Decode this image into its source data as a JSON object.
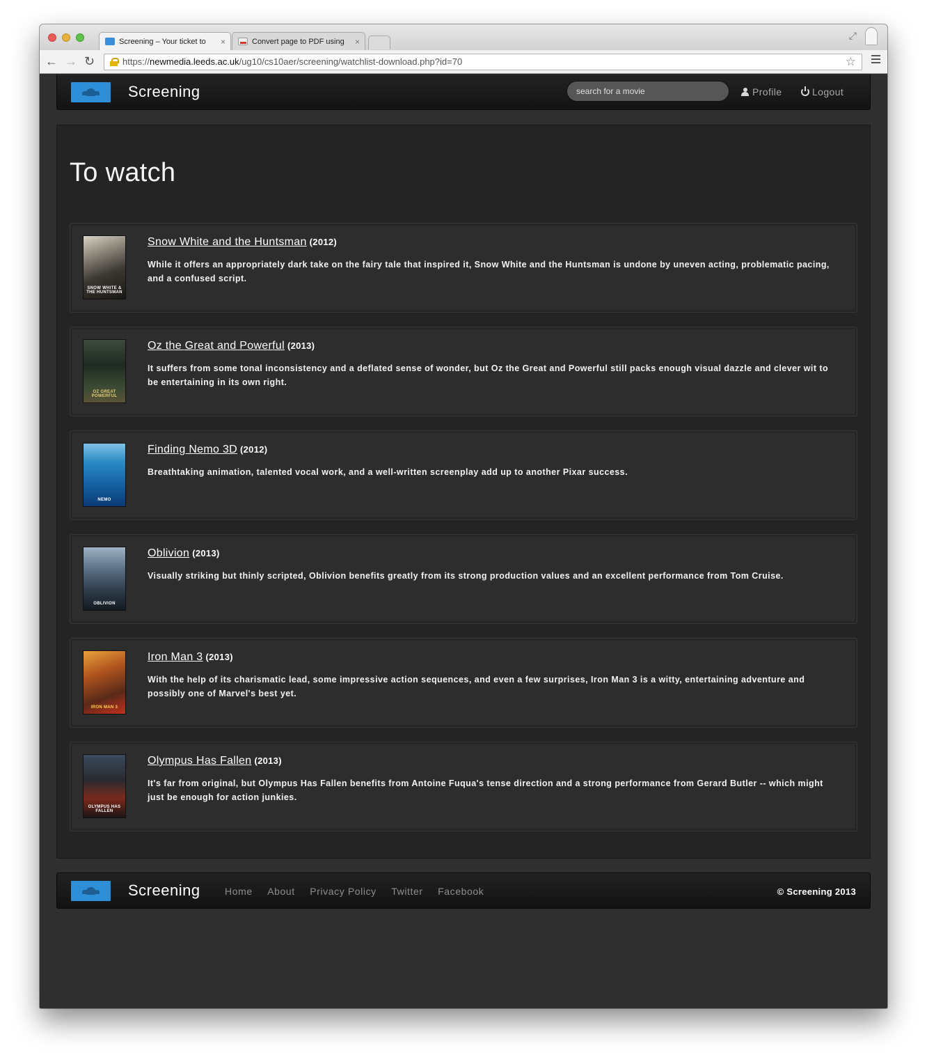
{
  "browser": {
    "tabs": [
      {
        "label": "Screening – Your ticket to"
      },
      {
        "label": "Convert page to PDF using"
      }
    ],
    "url_scheme": "https://",
    "url_host": "newmedia.leeds.ac.uk",
    "url_path": "/ug10/cs10aer/screening/watchlist-download.php?id=70"
  },
  "navbar": {
    "brand": "Screening",
    "search_placeholder": "search for a movie",
    "profile_label": "Profile",
    "logout_label": "Logout"
  },
  "main": {
    "title": "To watch",
    "movies": [
      {
        "title": "Snow White and the Huntsman",
        "year": "(2012)",
        "description": "While it offers an appropriately dark take on the fairy tale that inspired it, Snow White and the Huntsman is undone by uneven acting, problematic pacing, and a confused script.",
        "poster_text": "SNOW WHITE & THE HUNTSMAN"
      },
      {
        "title": "Oz the Great and Powerful",
        "year": "(2013)",
        "description": "It suffers from some tonal inconsistency and a deflated sense of wonder, but Oz the Great and Powerful still packs enough visual dazzle and clever wit to be entertaining in its own right.",
        "poster_text": "OZ GREAT POWERFUL"
      },
      {
        "title": "Finding Nemo 3D",
        "year": "(2012)",
        "description": "Breathtaking animation, talented vocal work, and a well-written screenplay add up to another Pixar success.",
        "poster_text": "NEMO"
      },
      {
        "title": "Oblivion",
        "year": "(2013)",
        "description": "Visually striking but thinly scripted, Oblivion benefits greatly from its strong production values and an excellent performance from Tom Cruise.",
        "poster_text": "OBLIVION"
      },
      {
        "title": "Iron Man 3",
        "year": "(2013)",
        "description": "With the help of its charismatic lead, some impressive action sequences, and even a few surprises, Iron Man 3 is a witty, entertaining adventure and possibly one of Marvel's best yet.",
        "poster_text": "IRON MAN 3"
      },
      {
        "title": "Olympus Has Fallen",
        "year": "(2013)",
        "description": "It's far from original, but Olympus Has Fallen benefits from Antoine Fuqua's tense direction and a strong performance from Gerard Butler -- which might just be enough for action junkies.",
        "poster_text": "OLYMPUS HAS FALLEN"
      }
    ]
  },
  "footer": {
    "brand": "Screening",
    "links": [
      "Home",
      "About",
      "Privacy Policy",
      "Twitter",
      "Facebook"
    ],
    "copyright": "© Screening 2013"
  },
  "colors": {
    "accent": "#2c8fd8",
    "navbar_bg": "#1a1a1a",
    "content_bg": "#242424",
    "card_bg": "#2d2d2d"
  }
}
